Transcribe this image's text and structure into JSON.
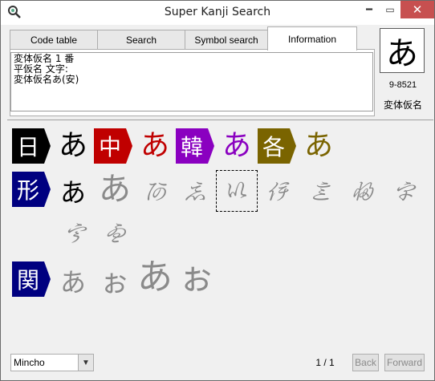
{
  "window": {
    "title": "Super Kanji Search"
  },
  "tabs": [
    {
      "label": "Code table"
    },
    {
      "label": "Search"
    },
    {
      "label": "Symbol search"
    },
    {
      "label": "Information"
    }
  ],
  "info": {
    "lines": [
      "変体仮名 1 番",
      "平仮名 文字:",
      "変体仮名あ(安)"
    ]
  },
  "character": {
    "glyph": "あ",
    "code": "9-8521",
    "category": "変体仮名"
  },
  "rows": {
    "row1": {
      "items": [
        {
          "tag": "日",
          "glyph": "あ",
          "color": "#111111",
          "fill": "#000000"
        },
        {
          "tag": "中",
          "glyph": "あ",
          "color": "#c00000",
          "fill": "#c00000"
        },
        {
          "tag": "韓",
          "glyph": "あ",
          "color": "#8a00c0",
          "fill": "#8a00c0"
        },
        {
          "tag": "各",
          "glyph": "あ",
          "color": "#7a6400",
          "fill": "#7a6400"
        }
      ]
    },
    "row2": {
      "tag": "形",
      "fill": "#000080",
      "glyphs": [
        "あ",
        "あ",
        "𛀄",
        "𛀅",
        "𛀆",
        "𛀇",
        "𛀈",
        "𛀉",
        "𛀊",
        "𛀋",
        "𛀌"
      ]
    },
    "row3": {
      "tag": "関",
      "fill": "#000080",
      "glyphs": [
        "あ",
        "ぉ",
        "あ",
        "ぉ"
      ]
    }
  },
  "font_select": {
    "value": "Mincho"
  },
  "pager": {
    "page": "1 / 1",
    "back": "Back",
    "forward": "Forward"
  }
}
